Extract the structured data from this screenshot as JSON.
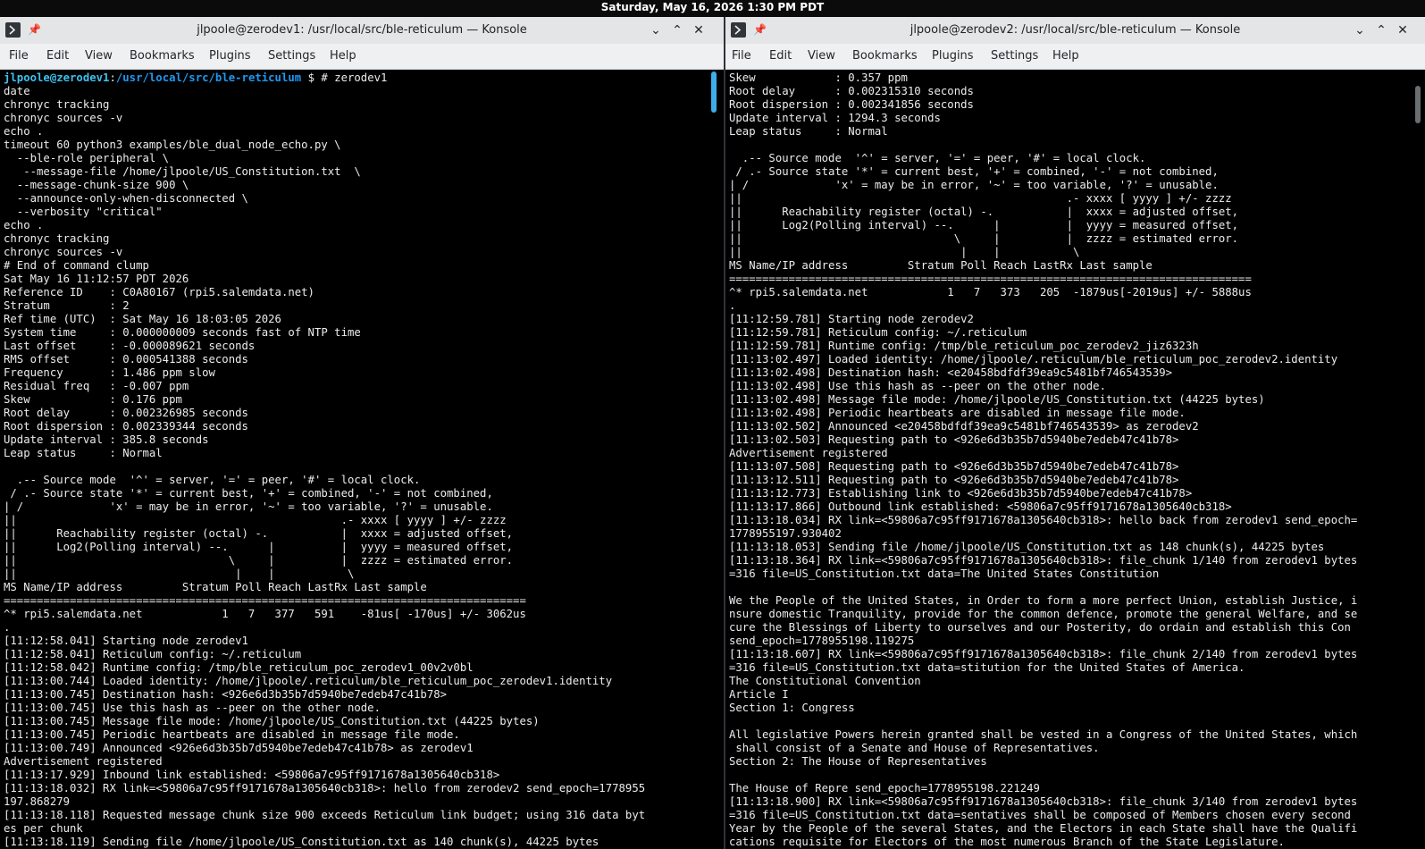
{
  "topbar": {
    "clock": "Saturday, May 16, 2026  1:30 PM PDT"
  },
  "colors": {
    "accent": "#3daee9",
    "prompt_user": "#3dc1f0",
    "prompt_path": "#1d99f3",
    "terminal_bg": "#000000",
    "terminal_fg": "#ececec"
  },
  "menu": [
    "File",
    "Edit",
    "View",
    "Bookmarks",
    "Plugins",
    "Settings",
    "Help"
  ],
  "icons": {
    "app": "terminal-icon",
    "pin": "pin-icon",
    "minimize": "chevron-down-icon",
    "maximize": "chevron-up-icon",
    "close": "close-icon"
  },
  "left": {
    "title": "jlpoole@zerodev1: /usr/local/src/ble-reticulum — Konsole",
    "prompt_user": "jlpoole@zerodev1",
    "prompt_sep": ":",
    "prompt_path": "/usr/local/src/ble-reticulum",
    "prompt_cmd": " $ # zerodev1",
    "output": "date\nchronyc tracking\nchronyc sources -v\necho .\ntimeout 60 python3 examples/ble_dual_node_echo.py \\\n  --ble-role peripheral \\\n   --message-file /home/jlpoole/US_Constitution.txt  \\\n  --message-chunk-size 900 \\\n  --announce-only-when-disconnected \\\n  --verbosity \"critical\"\necho .\nchronyc tracking\nchronyc sources -v\n# End of command clump\nSat May 16 11:12:57 PDT 2026\nReference ID    : C0A80167 (rpi5.salemdata.net)\nStratum         : 2\nRef time (UTC)  : Sat May 16 18:03:05 2026\nSystem time     : 0.000000009 seconds fast of NTP time\nLast offset     : -0.000089621 seconds\nRMS offset      : 0.000541388 seconds\nFrequency       : 1.486 ppm slow\nResidual freq   : -0.007 ppm\nSkew            : 0.176 ppm\nRoot delay      : 0.002326985 seconds\nRoot dispersion : 0.002339344 seconds\nUpdate interval : 385.8 seconds\nLeap status     : Normal\n\n  .-- Source mode  '^' = server, '=' = peer, '#' = local clock.\n / .- Source state '*' = current best, '+' = combined, '-' = not combined,\n| /             'x' = may be in error, '~' = too variable, '?' = unusable.\n||                                                 .- xxxx [ yyyy ] +/- zzzz\n||      Reachability register (octal) -.           |  xxxx = adjusted offset,\n||      Log2(Polling interval) --.      |          |  yyyy = measured offset,\n||                                \\     |          |  zzzz = estimated error.\n||                                 |    |           \\\nMS Name/IP address         Stratum Poll Reach LastRx Last sample\n===============================================================================\n^* rpi5.salemdata.net            1   7   377   591    -81us[ -170us] +/- 3062us\n.\n[11:12:58.041] Starting node zerodev1\n[11:12:58.041] Reticulum config: ~/.reticulum\n[11:12:58.042] Runtime config: /tmp/ble_reticulum_poc_zerodev1_00v2v0bl\n[11:13:00.744] Loaded identity: /home/jlpoole/.reticulum/ble_reticulum_poc_zerodev1.identity\n[11:13:00.745] Destination hash: <926e6d3b35b7d5940be7edeb47c41b78>\n[11:13:00.745] Use this hash as --peer on the other node.\n[11:13:00.745] Message file mode: /home/jlpoole/US_Constitution.txt (44225 bytes)\n[11:13:00.745] Periodic heartbeats are disabled in message file mode.\n[11:13:00.749] Announced <926e6d3b35b7d5940be7edeb47c41b78> as zerodev1\nAdvertisement registered\n[11:13:17.929] Inbound link established: <59806a7c95ff9171678a1305640cb318>\n[11:13:18.032] RX link=<59806a7c95ff9171678a1305640cb318>: hello from zerodev2 send_epoch=1778955\n197.868279\n[11:13:18.118] Requested message chunk size 900 exceeds Reticulum link budget; using 316 data byt\nes per chunk\n[11:13:18.119] Sending file /home/jlpoole/US_Constitution.txt as 140 chunk(s), 44225 bytes"
  },
  "right": {
    "title": "jlpoole@zerodev2: /usr/local/src/ble-reticulum — Konsole",
    "output": "Skew            : 0.357 ppm\nRoot delay      : 0.002315310 seconds\nRoot dispersion : 0.002341856 seconds\nUpdate interval : 1294.3 seconds\nLeap status     : Normal\n\n  .-- Source mode  '^' = server, '=' = peer, '#' = local clock.\n / .- Source state '*' = current best, '+' = combined, '-' = not combined,\n| /             'x' = may be in error, '~' = too variable, '?' = unusable.\n||                                                 .- xxxx [ yyyy ] +/- zzzz\n||      Reachability register (octal) -.           |  xxxx = adjusted offset,\n||      Log2(Polling interval) --.      |          |  yyyy = measured offset,\n||                                \\     |          |  zzzz = estimated error.\n||                                 |    |           \\\nMS Name/IP address         Stratum Poll Reach LastRx Last sample\n===============================================================================\n^* rpi5.salemdata.net            1   7   373   205  -1879us[-2019us] +/- 5888us\n.\n[11:12:59.781] Starting node zerodev2\n[11:12:59.781] Reticulum config: ~/.reticulum\n[11:12:59.781] Runtime config: /tmp/ble_reticulum_poc_zerodev2_jiz6323h\n[11:13:02.497] Loaded identity: /home/jlpoole/.reticulum/ble_reticulum_poc_zerodev2.identity\n[11:13:02.498] Destination hash: <e20458bdfdf39ea9c5481bf746543539>\n[11:13:02.498] Use this hash as --peer on the other node.\n[11:13:02.498] Message file mode: /home/jlpoole/US_Constitution.txt (44225 bytes)\n[11:13:02.498] Periodic heartbeats are disabled in message file mode.\n[11:13:02.502] Announced <e20458bdfdf39ea9c5481bf746543539> as zerodev2\n[11:13:02.503] Requesting path to <926e6d3b35b7d5940be7edeb47c41b78>\nAdvertisement registered\n[11:13:07.508] Requesting path to <926e6d3b35b7d5940be7edeb47c41b78>\n[11:13:12.511] Requesting path to <926e6d3b35b7d5940be7edeb47c41b78>\n[11:13:12.773] Establishing link to <926e6d3b35b7d5940be7edeb47c41b78>\n[11:13:17.866] Outbound link established: <59806a7c95ff9171678a1305640cb318>\n[11:13:18.034] RX link=<59806a7c95ff9171678a1305640cb318>: hello back from zerodev1 send_epoch=\n1778955197.930402\n[11:13:18.053] Sending file /home/jlpoole/US_Constitution.txt as 148 chunk(s), 44225 bytes\n[11:13:18.364] RX link=<59806a7c95ff9171678a1305640cb318>: file_chunk 1/140 from zerodev1 bytes\n=316 file=US_Constitution.txt data=The United States Constitution\n\nWe the People of the United States, in Order to form a more perfect Union, establish Justice, i\nnsure domestic Tranquility, provide for the common defence, promote the general Welfare, and se\ncure the Blessings of Liberty to ourselves and our Posterity, do ordain and establish this Con\nsend_epoch=1778955198.119275\n[11:13:18.607] RX link=<59806a7c95ff9171678a1305640cb318>: file_chunk 2/140 from zerodev1 bytes\n=316 file=US_Constitution.txt data=stitution for the United States of America.\nThe Constitutional Convention\nArticle I\nSection 1: Congress\n\nAll legislative Powers herein granted shall be vested in a Congress of the United States, which\n shall consist of a Senate and House of Representatives.\nSection 2: The House of Representatives\n\nThe House of Repre send_epoch=1778955198.221249\n[11:13:18.900] RX link=<59806a7c95ff9171678a1305640cb318>: file_chunk 3/140 from zerodev1 bytes\n=316 file=US_Constitution.txt data=sentatives shall be composed of Members chosen every second\nYear by the People of the several States, and the Electors in each State shall have the Qualifi\ncations requisite for Electors of the most numerous Branch of the State Legislature."
  }
}
